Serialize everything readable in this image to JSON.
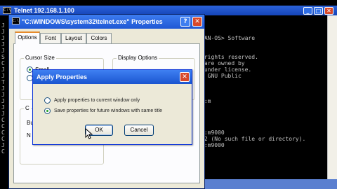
{
  "console": {
    "title": "Telnet 192.168.1.100",
    "icon": "C:\\",
    "minimize": "_",
    "maximize": "□",
    "close": "✕",
    "left_chars": [
      "J",
      "J",
      "J",
      "J",
      "J",
      "S",
      "C",
      "J",
      "J",
      "T",
      "J",
      "J",
      "J",
      "J",
      "J",
      "C",
      "C",
      "C",
      "C",
      "J",
      "C"
    ],
    "lines": [
      "SAN-OS> Software",
      "",
      "",
      " rights reserved.",
      " are owned by",
      " under license.",
      "e GNU Public",
      "",
      "",
      "",
      "h:m",
      "",
      "",
      "",
      "",
      "h:m9000",
      "02 (No such file or directory).",
      "h:m9000"
    ]
  },
  "properties": {
    "title": "\"C:\\WINDOWS\\system32\\telnet.exe\" Properties",
    "help": "?",
    "close": "✕",
    "tabs": [
      "Options",
      "Font",
      "Layout",
      "Colors"
    ],
    "cursor_size_label": "Cursor Size",
    "cursor_small": "Small",
    "display_options_label": "Display Options",
    "partial_labels": {
      "a": "C",
      "b": "Bu",
      "c": "N"
    }
  },
  "apply_dialog": {
    "title": "Apply Properties",
    "close": "✕",
    "option_current": "Apply properties to current window only",
    "option_future": "Save properties for future windows with same title",
    "ok": "OK",
    "cancel": "Cancel"
  }
}
